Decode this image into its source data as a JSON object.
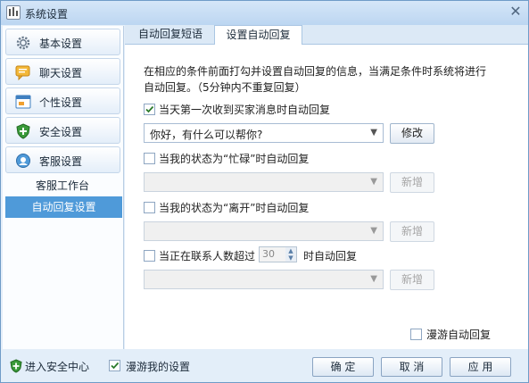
{
  "window": {
    "title": "系统设置"
  },
  "sidebar": {
    "items": [
      {
        "label": "基本设置",
        "icon": "gear-icon"
      },
      {
        "label": "聊天设置",
        "icon": "chat-icon"
      },
      {
        "label": "个性设置",
        "icon": "window-icon"
      },
      {
        "label": "安全设置",
        "icon": "shield-icon"
      },
      {
        "label": "客服设置",
        "icon": "service-icon"
      }
    ],
    "sub_items": [
      {
        "label": "客服工作台",
        "active": false
      },
      {
        "label": "自动回复设置",
        "active": true
      }
    ]
  },
  "tabs": [
    {
      "label": "自动回复短语",
      "active": false
    },
    {
      "label": "设置自动回复",
      "active": true
    }
  ],
  "main": {
    "description": "在相应的条件前面打勾并设置自动回复的信息，当满足条件时系统将进行自动回复。（5分钟内不重复回复）",
    "rules": [
      {
        "label": "当天第一次收到买家消息时自动回复",
        "checked": true,
        "value": "你好，有什么可以帮你?",
        "button": "修改",
        "enabled": true
      },
      {
        "label": "当我的状态为“忙碌”时自动回复",
        "checked": false,
        "value": "",
        "button": "新增",
        "enabled": false
      },
      {
        "label": "当我的状态为“离开”时自动回复",
        "checked": false,
        "value": "",
        "button": "新增",
        "enabled": false
      },
      {
        "label_prefix": "当正在联系人数超过",
        "count": "30",
        "label_suffix": "时自动回复",
        "checked": false,
        "value": "",
        "button": "新增",
        "enabled": false
      }
    ],
    "roaming_reply": {
      "label": "漫游自动回复",
      "checked": false
    }
  },
  "footer": {
    "security_center": "进入安全中心",
    "roam_settings": {
      "label": "漫游我的设置",
      "checked": true
    },
    "buttons": {
      "ok": "确 定",
      "cancel": "取 消",
      "apply": "应 用"
    }
  },
  "colors": {
    "accent": "#4f9ad9",
    "titlebar": "#c8ddf4",
    "check": "#2a7a2a",
    "shield": "#3a9a3a"
  }
}
